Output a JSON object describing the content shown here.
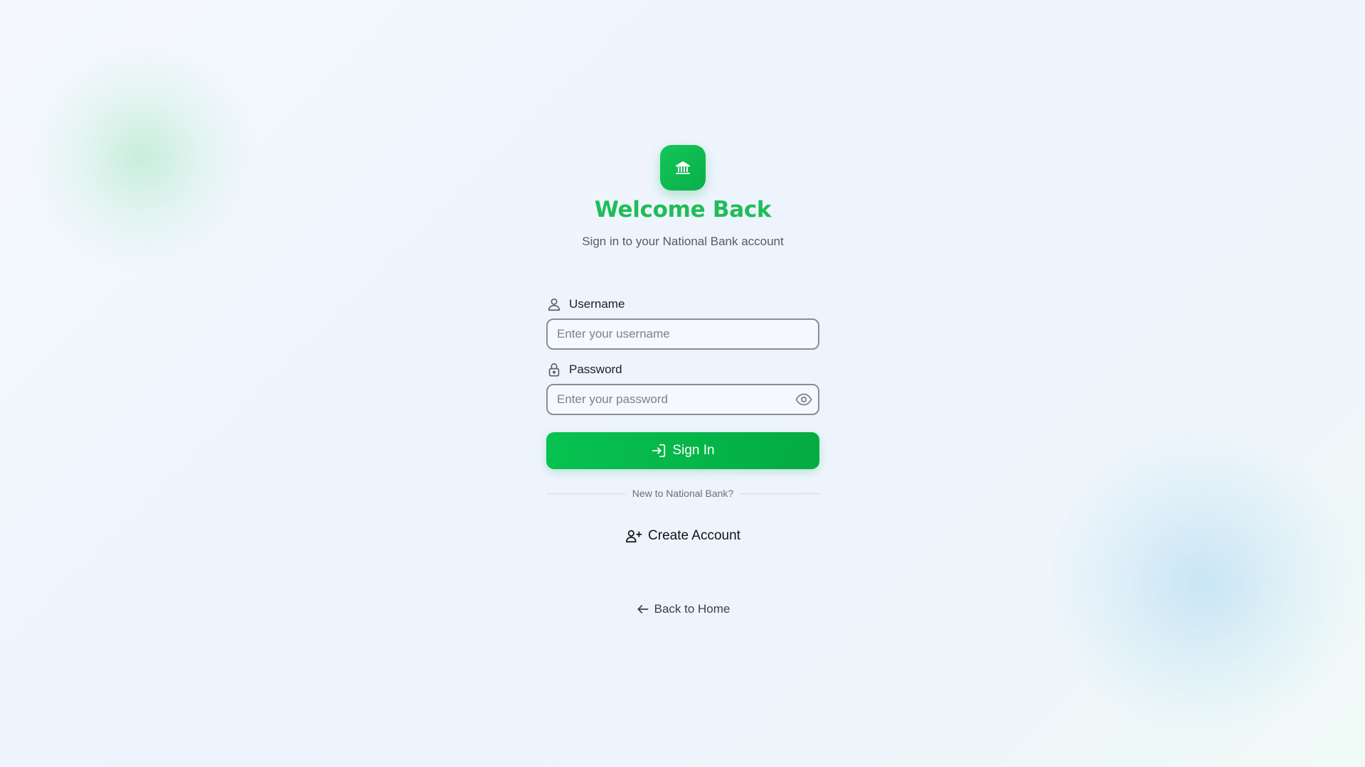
{
  "colors": {
    "brand_green": "#1fbd58",
    "button_green": "#07c250",
    "background": "#eef4fd"
  },
  "logo": {
    "icon": "bank-icon"
  },
  "header": {
    "title": "Welcome Back",
    "subtitle": "Sign in to your National Bank account"
  },
  "form": {
    "username": {
      "label": "Username",
      "icon": "user-icon",
      "value": "",
      "placeholder": "Enter your username"
    },
    "password": {
      "label": "Password",
      "icon": "lock-icon",
      "value": "",
      "placeholder": "Enter your password",
      "toggle_icon": "eye-icon"
    },
    "submit": {
      "label": "Sign In",
      "icon": "sign-in-icon"
    }
  },
  "divider": {
    "text": "New to National Bank?"
  },
  "create_account": {
    "label": "Create Account",
    "icon": "user-plus-icon"
  },
  "back": {
    "label": "Back to Home",
    "icon": "arrow-left-icon"
  }
}
